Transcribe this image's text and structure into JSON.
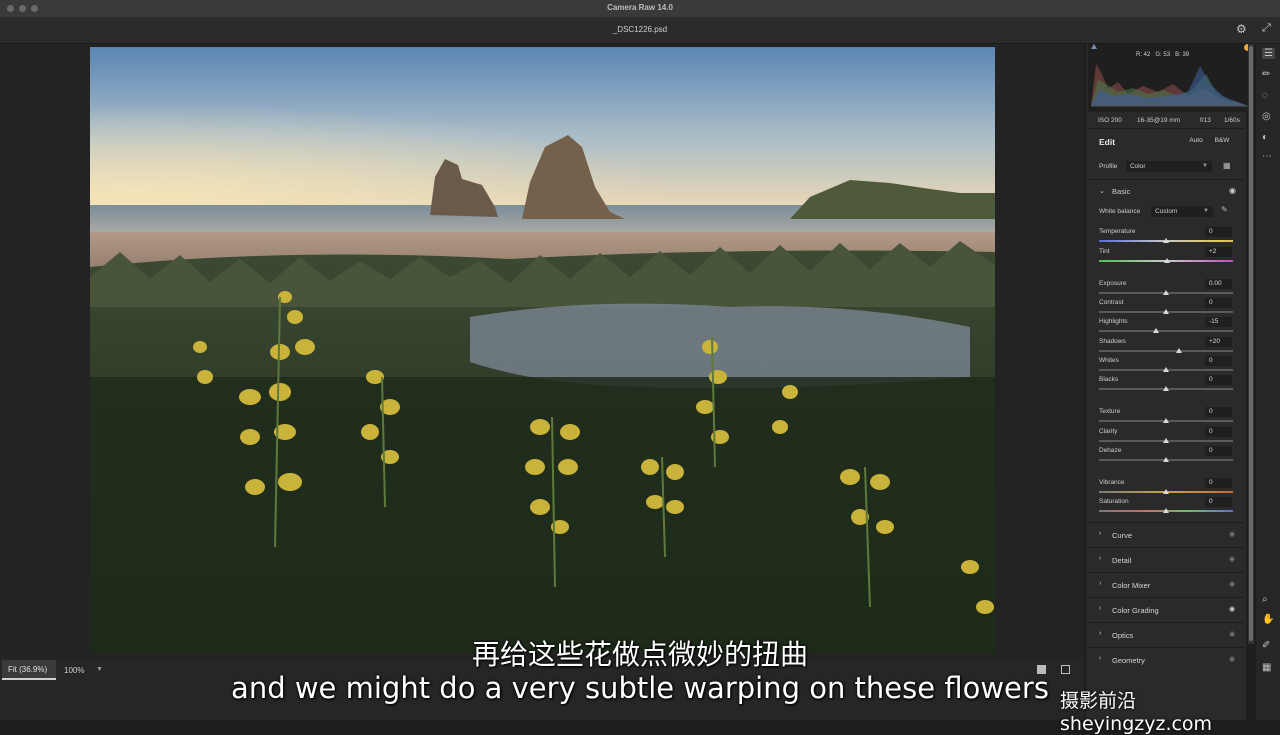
{
  "window": {
    "app_title": "Camera Raw 14.0",
    "document_title": "_DSC1226.psd"
  },
  "histogram": {
    "r_label": "R:",
    "r": "42",
    "g_label": "G:",
    "g": "53",
    "b_label": "B:",
    "b": "39"
  },
  "exif": {
    "iso": "ISO 200",
    "lens": "16-35@19 mm",
    "aperture": "f/13",
    "shutter": "1/60s"
  },
  "edit": {
    "title": "Edit",
    "auto_label": "Auto",
    "bw_label": "B&W"
  },
  "profile": {
    "label": "Profile",
    "value": "Color"
  },
  "basic": {
    "title": "Basic",
    "white_balance": {
      "label": "White balance",
      "value": "Custom"
    },
    "temperature": {
      "label": "Temperature",
      "value": "0",
      "level": 0.5
    },
    "tint": {
      "label": "Tint",
      "value": "+2",
      "level": 0.51
    },
    "exposure": {
      "label": "Exposure",
      "value": "0.00",
      "level": 0.5
    },
    "contrast": {
      "label": "Contrast",
      "value": "0",
      "level": 0.5
    },
    "highlights": {
      "label": "Highlights",
      "value": "-15",
      "level": 0.425
    },
    "shadows": {
      "label": "Shadows",
      "value": "+20",
      "level": 0.6
    },
    "whites": {
      "label": "Whites",
      "value": "0",
      "level": 0.5
    },
    "blacks": {
      "label": "Blacks",
      "value": "0",
      "level": 0.5
    },
    "texture": {
      "label": "Texture",
      "value": "0",
      "level": 0.5
    },
    "clarity": {
      "label": "Clarity",
      "value": "0",
      "level": 0.5
    },
    "dehaze": {
      "label": "Dehaze",
      "value": "0",
      "level": 0.5
    },
    "vibrance": {
      "label": "Vibrance",
      "value": "0",
      "level": 0.5
    },
    "saturation": {
      "label": "Saturation",
      "value": "0",
      "level": 0.5
    }
  },
  "sections": {
    "curve": "Curve",
    "detail": "Detail",
    "color_mixer": "Color Mixer",
    "color_grading": "Color Grading",
    "optics": "Optics",
    "geometry": "Geometry"
  },
  "zoom": {
    "fit_label": "Fit (36.9%)",
    "percent_label": "100%"
  },
  "subtitles": {
    "chinese": "再给这些花做点微妙的扭曲",
    "english": "and we might do a very subtle warping on these flowers"
  },
  "watermark": "摄影前沿 sheyingzyz.com",
  "icons": {
    "settings": "gear-icon",
    "fullscreen": "expand-icon",
    "edit_sliders": "sliders-icon",
    "brush": "brush-icon",
    "heal": "heal-icon",
    "red_eye": "eye-icon",
    "presets": "presets-icon",
    "more": "more-icon",
    "zoom": "magnifier-icon",
    "hand": "hand-icon",
    "color_sampler": "eyedropper-icon",
    "grid": "grid-icon"
  },
  "colors": {
    "accent_orange": "#e8a53a",
    "temperature_track": "#6f7fd8",
    "tint_track": "#6ac06a"
  }
}
